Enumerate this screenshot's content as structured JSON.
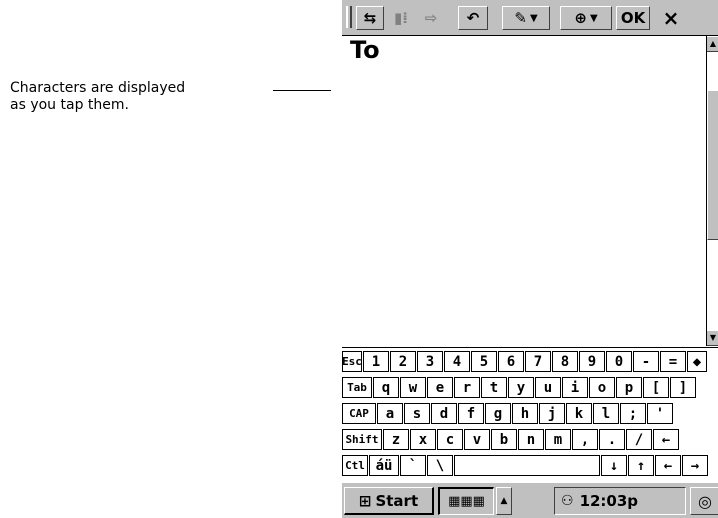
{
  "callout": {
    "line1": "Characters are displayed",
    "line2": "as you tap them."
  },
  "toolbar": {
    "buttons": [
      {
        "icon": "format-toggle-icon",
        "glyph": "⇆"
      },
      {
        "icon": "indent-left-icon",
        "glyph": "▮⁞"
      },
      {
        "icon": "indent-right-icon",
        "glyph": "⇨"
      },
      {
        "icon": "undo-icon",
        "glyph": "↶"
      },
      {
        "icon": "pen-tool-icon",
        "glyph": "✎"
      },
      {
        "icon": "zoom-icon",
        "glyph": "⊕"
      }
    ],
    "ok_label": "OK",
    "close_label": "×"
  },
  "document": {
    "text": "To"
  },
  "keyboard": {
    "rows": [
      [
        "Esc",
        "1",
        "2",
        "3",
        "4",
        "5",
        "6",
        "7",
        "8",
        "9",
        "0",
        "-",
        "=",
        "◆"
      ],
      [
        "Tab",
        "q",
        "w",
        "e",
        "r",
        "t",
        "y",
        "u",
        "i",
        "o",
        "p",
        "[",
        "]"
      ],
      [
        "CAP",
        "a",
        "s",
        "d",
        "f",
        "g",
        "h",
        "j",
        "k",
        "l",
        ";",
        "'"
      ],
      [
        "Shift",
        "z",
        "x",
        "c",
        "v",
        "b",
        "n",
        "m",
        ",",
        ".",
        "/",
        "←"
      ],
      [
        "Ctl",
        "áü",
        "`",
        "\\",
        "",
        "↓",
        "↑",
        "←",
        "→"
      ]
    ]
  },
  "taskbar": {
    "start_label": "Start",
    "keyboard_label": "▦▦▦",
    "sip_arrow": "▲",
    "clock": "12:03p",
    "tray_icon": "⚇",
    "desktop_icon": "◎"
  }
}
